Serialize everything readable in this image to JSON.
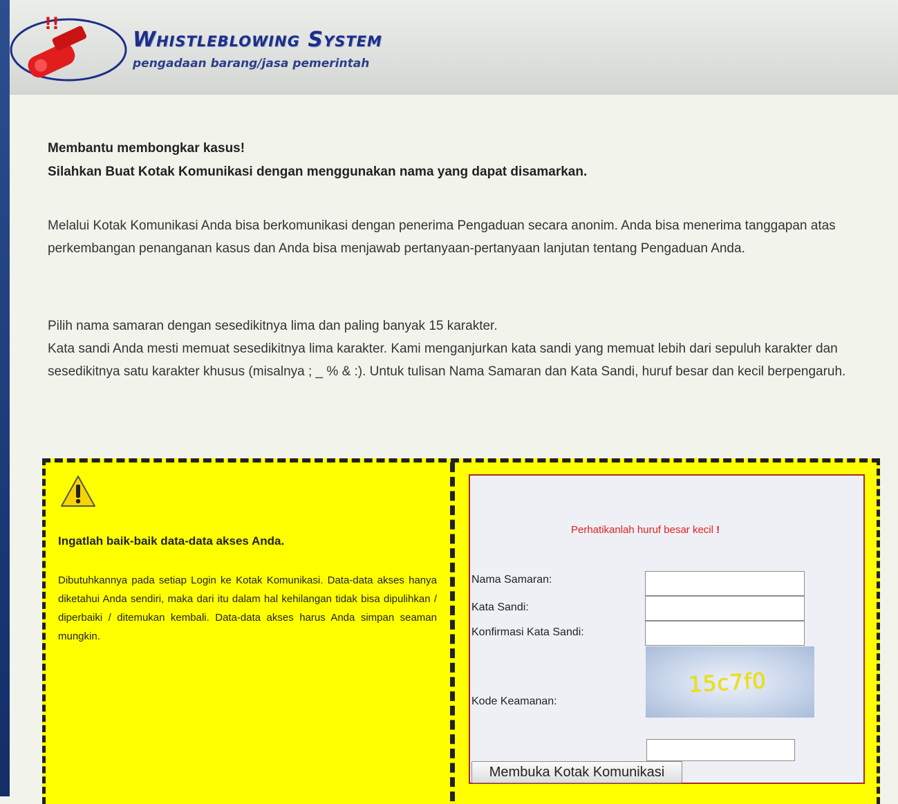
{
  "header": {
    "title": "Whistleblowing System",
    "subtitle": "pengadaan barang/jasa pemerintah"
  },
  "intro": {
    "line1": "Membantu membongkar kasus!",
    "line2": "Silahkan Buat Kotak Komunikasi dengan menggunakan nama yang dapat disamarkan."
  },
  "paragraph1": "Melalui Kotak Komunikasi Anda bisa berkomunikasi dengan penerima Pengaduan secara anonim. Anda bisa menerima tanggapan atas perkembangan penanganan kasus dan Anda bisa menjawab pertanyaan-pertanyaan lanjutan tentang Pengaduan Anda.",
  "paragraph2a": "Pilih nama samaran dengan sesedikitnya lima dan paling banyak 15 karakter.",
  "paragraph2b": "Kata sandi Anda mesti memuat sesedikitnya lima karakter. Kami menganjurkan kata sandi yang memuat lebih dari sepuluh karakter dan sesedikitnya satu karakter khusus (misalnya ; _ % & :). Untuk tulisan Nama Samaran dan Kata Sandi, huruf besar dan kecil berpengaruh.",
  "warning": {
    "icon": "warning-triangle-icon",
    "title": "Ingatlah baik-baik data-data akses Anda.",
    "text": "Dibutuhkannya pada setiap Login ke Kotak Komunikasi. Data-data akses hanya diketahui Anda sendiri, maka dari itu dalam hal kehilangan tidak bisa dipulihkan / diperbaiki / ditemukan kembali. Data-data akses harus Anda simpan seaman mungkin."
  },
  "form": {
    "hint": "Perhatikanlah huruf besar kecil",
    "hint_mark": "!",
    "nama_label": "Nama Samaran:",
    "sandi_label": "Kata Sandi:",
    "konfirmasi_label": "Konfirmasi Kata Sandi:",
    "kode_label": "Kode Keamanan:",
    "captcha_text": "15c7f0",
    "nama_value": "",
    "sandi_value": "",
    "konfirmasi_value": "",
    "kode_value": "",
    "submit_label": "Membuka Kotak Komunikasi"
  },
  "colors": {
    "brand": "#1c2f8a",
    "warning_bg": "#ffff00",
    "hint": "#e02020",
    "form_border": "#a52a2a"
  }
}
